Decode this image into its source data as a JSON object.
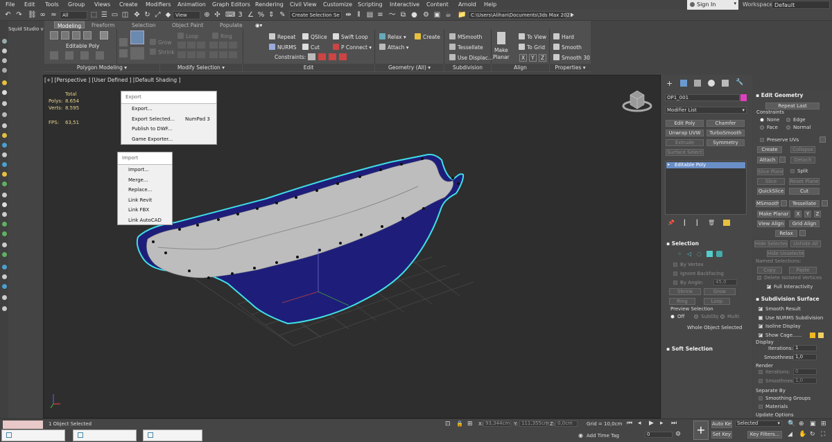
{
  "menubar": {
    "items": [
      "File",
      "Edit",
      "Tools",
      "Group",
      "Views",
      "Create",
      "Modifiers",
      "Animation",
      "Graph Editors",
      "Rendering",
      "Civil View",
      "Customize",
      "Scripting",
      "Interactive",
      "Content",
      "Arnold",
      "Help"
    ],
    "signin": "Sign In",
    "workspaces_label": "Workspaces:",
    "workspace_value": "Default"
  },
  "toolbar": {
    "filter_value": "All",
    "view_value": "View",
    "selection_set": "Create Selection Se",
    "path": "C:\\Users\\Alihan\\Documents\\3ds Max 2021"
  },
  "ribbon": {
    "tabs": [
      "Modeling",
      "Freeform",
      "Selection",
      "Object Paint",
      "Populate"
    ],
    "editable_poly": "Editable Poly",
    "modify_grow": "Grow",
    "modify_shrink": "Shrink",
    "loop": "Loop",
    "ring": "Ring",
    "edit_repeat": "Repeat",
    "edit_qslice": "QSlice",
    "edit_swiftloop": "Swift Loop",
    "edit_nurms": "NURMS",
    "edit_cut": "Cut",
    "edit_pconnect": "P Connect",
    "edit_constraints": "Constraints:",
    "geom_relax": "Relax",
    "geom_create": "Create",
    "geom_attach": "Attach",
    "subdiv_msmooth": "MSmooth",
    "subdiv_tessellate": "Tessellate",
    "subdiv_usedisplace": "Use Displac...",
    "align_make": "Make",
    "align_planar": "Planar",
    "align_toview": "To View",
    "align_togrid": "To Grid",
    "align_x": "X",
    "align_y": "Y",
    "align_z": "Z",
    "props_hard": "Hard",
    "props_smooth": "Smooth",
    "props_smooth30": "Smooth 30",
    "groups": [
      "Polygon Modeling",
      "Modify Selection",
      "Edit",
      "Geometry (All)",
      "Subdivision",
      "Align",
      "Properties"
    ]
  },
  "left": {
    "squid": "Squid Studio v"
  },
  "viewport": {
    "label": "[+] [Perspective ] [User Defined ] [Default Shading ]",
    "stats": {
      "total": "Total",
      "polys_label": "Polys:",
      "polys": "8.654",
      "verts_label": "Verts:",
      "verts": "8.595",
      "fps_label": "FPS:",
      "fps": "63,51"
    },
    "export_menu": {
      "header": "Export",
      "items": [
        "Export...",
        "Export Selected...",
        "Publish to DWF...",
        "Game Exporter..."
      ],
      "shortcut": "NumPad 3"
    },
    "import_menu": {
      "header": "Import",
      "items": [
        "Import...",
        "Merge...",
        "Replace...",
        "Link Revit",
        "Link FBX",
        "Link AutoCAD"
      ]
    }
  },
  "cmdpanel": {
    "object_name": "OP1_001",
    "object_color": "#e040c0",
    "modifier_list": "Modifier List",
    "buttons": [
      "Edit Poly",
      "Chamfer",
      "Unwrap UVW",
      "TurboSmooth",
      "Extrude",
      "Symmetry",
      "Surface Select"
    ],
    "stack_item": "Editable Poly",
    "selection_head": "Selection",
    "by_vertex": "By Vertex",
    "ignore_backfacing": "Ignore Backfacing",
    "by_angle": "By Angle:",
    "by_angle_val": "45,0",
    "shrink": "Shrink",
    "grow": "Grow",
    "ring": "Ring",
    "loop": "Loop",
    "preview_selection": "Preview Selection",
    "off": "Off",
    "subobj": "SubObj",
    "multi": "Multi",
    "whole_object": "Whole Object Selected",
    "soft_selection": "Soft Selection"
  },
  "editgeo": {
    "head": "Edit Geometry",
    "repeat_last": "Repeat Last",
    "constraints": "Constraints",
    "none": "None",
    "edge": "Edge",
    "face": "Face",
    "normal": "Normal",
    "preserve_uvs": "Preserve UVs",
    "create": "Create",
    "collapse": "Collapse",
    "attach": "Attach",
    "detach": "Detach",
    "slice_plane": "Slice Plane",
    "split": "Split",
    "slice": "Slice",
    "reset_plane": "Reset Plane",
    "quickslice": "QuickSlice",
    "cut": "Cut",
    "msmooth": "MSmooth",
    "tessellate": "Tessellate",
    "make_planar": "Make Planar",
    "x": "X",
    "y": "Y",
    "z": "Z",
    "view_align": "View Align",
    "grid_align": "Grid Align",
    "relax": "Relax",
    "hide_selected": "Hide Selected",
    "unhide_all": "Unhide All",
    "hide_unselected": "Hide Unselected",
    "named_selections": "Named Selections:",
    "copy": "Copy",
    "paste": "Paste",
    "delete_isolated": "Delete Isolated Vertices",
    "full_interactivity": "Full Interactivity",
    "subdiv_head": "Subdivision Surface",
    "smooth_result": "Smooth Result",
    "use_nurms": "Use NURMS Subdivision",
    "isoline_display": "Isoline Display",
    "show_cage": "Show Cage......",
    "display": "Display",
    "iterations": "Iterations:",
    "iterations_val": "1",
    "smoothness": "Smoothness:",
    "smoothness_val": "1,0",
    "render": "Render",
    "r_iterations_val": "0",
    "r_smoothness_val": "1,0",
    "separate_by": "Separate By",
    "smoothing_groups": "Smoothing Groups",
    "materials": "Materials",
    "update_options": "Update Options"
  },
  "status": {
    "selected": "1 Object Selected",
    "x_label": "X:",
    "x_val": "93,344cm",
    "y_label": "Y:",
    "y_val": "111,355cm",
    "z_label": "Z:",
    "z_val": "0,0cm",
    "grid": "Grid = 10,0cm",
    "add_time_tag": "Add Time Tag",
    "frame": "0",
    "auto_key": "Auto Key",
    "selected_dd": "Selected",
    "set_key": "Set Key",
    "key_filters": "Key Filters...",
    "frame_right": "0"
  }
}
